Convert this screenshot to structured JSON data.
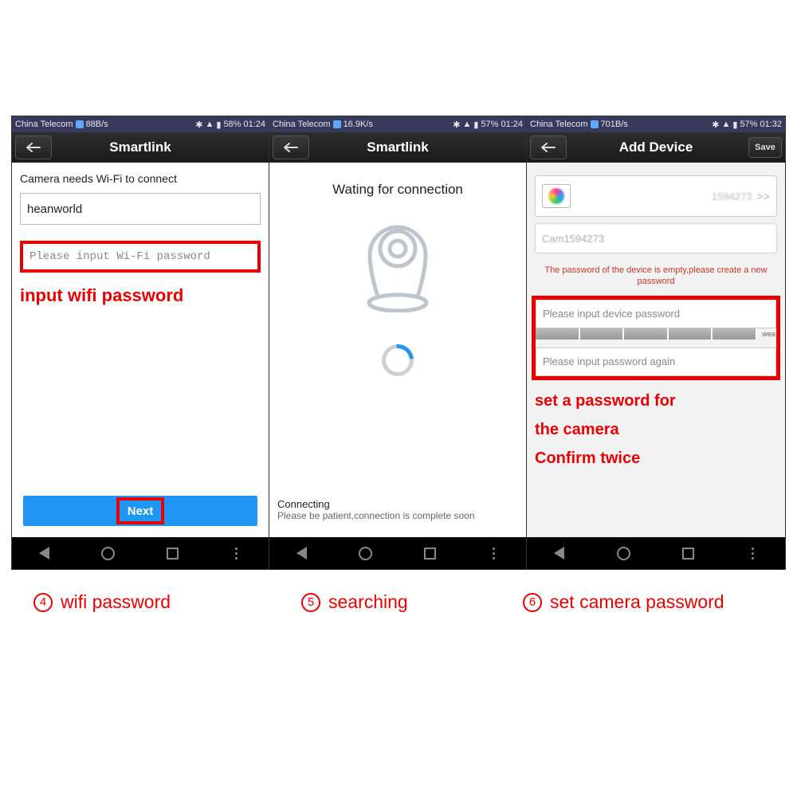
{
  "statusbar": {
    "carrier": "China Telecom",
    "speed1": "88B/s",
    "speed2": "16.9K/s",
    "speed3": "701B/s",
    "batt1": "58%",
    "batt2": "57%",
    "batt3": "57%",
    "time1": "01:24",
    "time2": "01:24",
    "time3": "01:32"
  },
  "panel1": {
    "header_title": "Smartlink",
    "connect_label": "Camera needs Wi-Fi to connect",
    "ssid_value": "heanworld",
    "pw_placeholder": "Please input Wi-Fi password",
    "annotation": "input wifi password",
    "next_label": "Next"
  },
  "panel2": {
    "header_title": "Smartlink",
    "waiting": "Wating for connection",
    "connecting": "Connecting",
    "patient": "Please be patient,connection is complete soon"
  },
  "panel3": {
    "header_title": "Add Device",
    "save": "Save",
    "device_id": "1594273",
    "arrow": ">>",
    "device_name": "Cam1594273",
    "warn": "The password of the device is empty,please create a new password",
    "pw1_placeholder": "Please input device password",
    "pw2_placeholder": "Please input password again",
    "meter_label": "wea",
    "annotation_l1": "set a password for",
    "annotation_l2": "the camera",
    "annotation_l3": "Confirm twice"
  },
  "captions": {
    "c1_num": "4",
    "c1_text": "wifi password",
    "c2_num": "5",
    "c2_text": "searching",
    "c3_num": "6",
    "c3_text": "set camera password"
  }
}
